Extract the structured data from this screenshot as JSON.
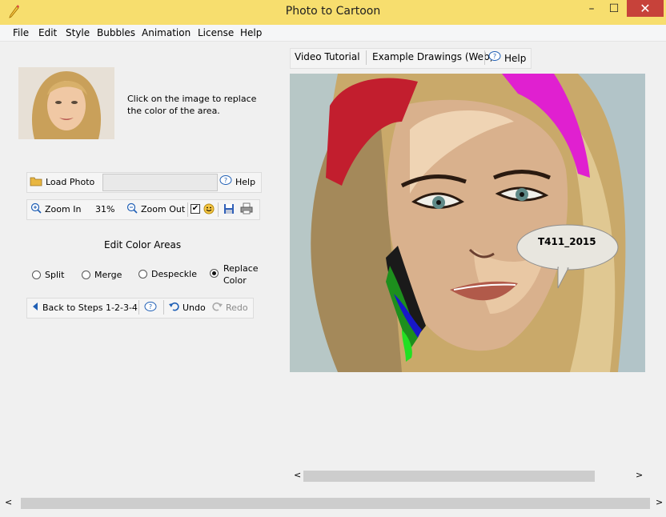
{
  "window": {
    "title": "Photo to Cartoon",
    "minimize": "–",
    "maximize": "☐",
    "close": "✕"
  },
  "menu": [
    "File",
    "Edit",
    "Style",
    "Bubbles",
    "Animation",
    "License",
    "Help"
  ],
  "left": {
    "hint": "Click on the image to replace the color of the area.",
    "load_photo": "Load Photo",
    "path_value": "",
    "help": "Help",
    "zoom_in": "Zoom In",
    "zoom_level": "31%",
    "zoom_out": "Zoom Out",
    "checkbox_checked": true,
    "edit_title": "Edit Color Areas",
    "options": [
      {
        "label": "Split",
        "selected": false
      },
      {
        "label": "Merge",
        "selected": false
      },
      {
        "label": "Despeckle",
        "selected": false
      },
      {
        "label": "Replace Color",
        "selected": true
      }
    ],
    "back": "Back to Steps 1-2-3-4",
    "undo": "Undo",
    "redo": "Redo"
  },
  "right": {
    "tabs": [
      "Video Tutorial",
      "Example Drawings (Web)",
      "Help"
    ],
    "bubble_text": "T411_2015"
  },
  "colors": {
    "titlebar": "#f7de6e",
    "close": "#c7423a",
    "accent_blue": "#1f5fb5"
  },
  "scroll": {
    "left_arrow": "<",
    "right_arrow": ">"
  }
}
